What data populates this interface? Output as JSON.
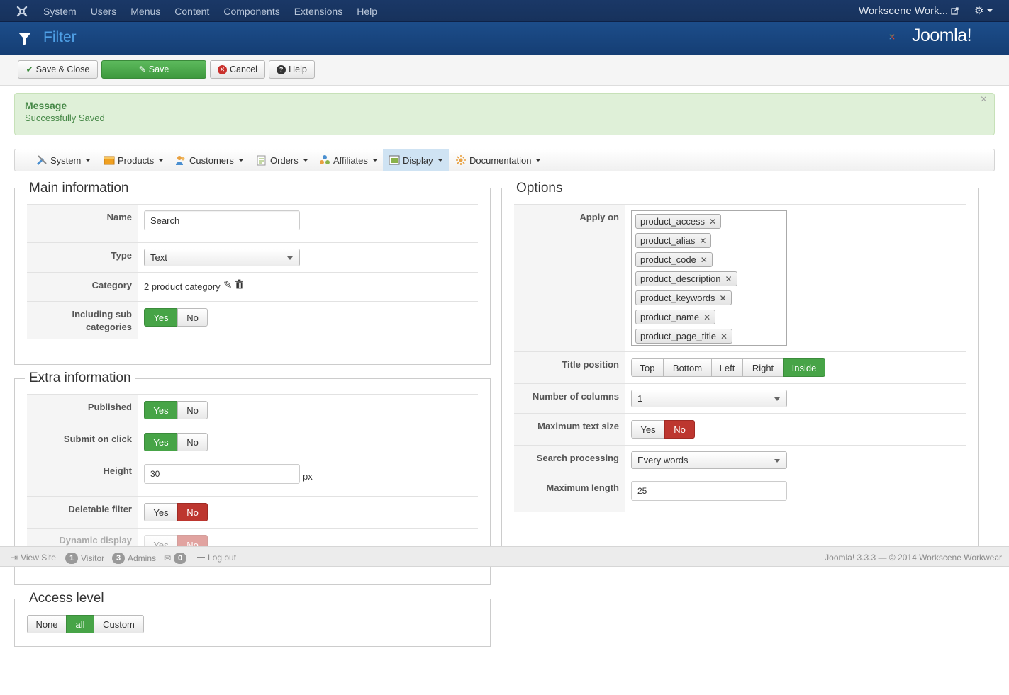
{
  "topbar": {
    "menu": [
      "System",
      "Users",
      "Menus",
      "Content",
      "Components",
      "Extensions",
      "Help"
    ],
    "site_name": "Workscene Work...",
    "icons": {
      "logo": "joomla-icon",
      "external": "external-link-icon",
      "settings": "gear-icon"
    }
  },
  "header": {
    "title": "Filter",
    "logo_text": "Joomla!"
  },
  "toolbar": {
    "save_close": "Save & Close",
    "save": "Save",
    "cancel": "Cancel",
    "help": "Help"
  },
  "message": {
    "heading": "Message",
    "text": "Successfully Saved",
    "close": "×"
  },
  "component_menu": {
    "items": [
      "System",
      "Products",
      "Customers",
      "Orders",
      "Affiliates",
      "Display",
      "Documentation"
    ],
    "active": "Display"
  },
  "main_info": {
    "legend": "Main information",
    "name_label": "Name",
    "name_value": "Search",
    "type_label": "Type",
    "type_value": "Text",
    "category_label": "Category",
    "category_value": "2 product category",
    "subcat_label": "Including sub categories",
    "subcat_yes": "Yes",
    "subcat_no": "No"
  },
  "extra_info": {
    "legend": "Extra information",
    "published_label": "Published",
    "submit_label": "Submit on click",
    "height_label": "Height",
    "height_value": "30",
    "height_unit": "px",
    "deletable_label": "Deletable filter",
    "dynamic_label": "Dynamic display",
    "yes": "Yes",
    "no": "No"
  },
  "access": {
    "legend": "Access level",
    "none": "None",
    "all": "all",
    "custom": "Custom"
  },
  "options": {
    "legend": "Options",
    "apply_label": "Apply on",
    "apply_values": [
      "product_access",
      "product_alias",
      "product_code",
      "product_description",
      "product_keywords",
      "product_name",
      "product_page_title"
    ],
    "chip_remove": "✕",
    "title_pos_label": "Title position",
    "title_positions": [
      "Top",
      "Bottom",
      "Left",
      "Right",
      "Inside"
    ],
    "columns_label": "Number of columns",
    "columns_value": "1",
    "maxtext_label": "Maximum text size",
    "maxtext_yes": "Yes",
    "maxtext_no": "No",
    "search_proc_label": "Search processing",
    "search_proc_value": "Every words",
    "maxlen_label": "Maximum length",
    "maxlen_value": "25"
  },
  "status": {
    "view_site": "View Site",
    "visitor_count": "1",
    "visitor": "Visitor",
    "admin_count": "3",
    "admins": "Admins",
    "msg_count": "0",
    "logout": "Log out",
    "footer": "Joomla! 3.3.3 — © 2014 Workscene Workwear"
  },
  "colors": {
    "navbar": "#17325c",
    "header": "#1c4d8a",
    "success_bg": "#dff0d8",
    "toggle_green": "#47a447",
    "toggle_red": "#bd362f"
  }
}
